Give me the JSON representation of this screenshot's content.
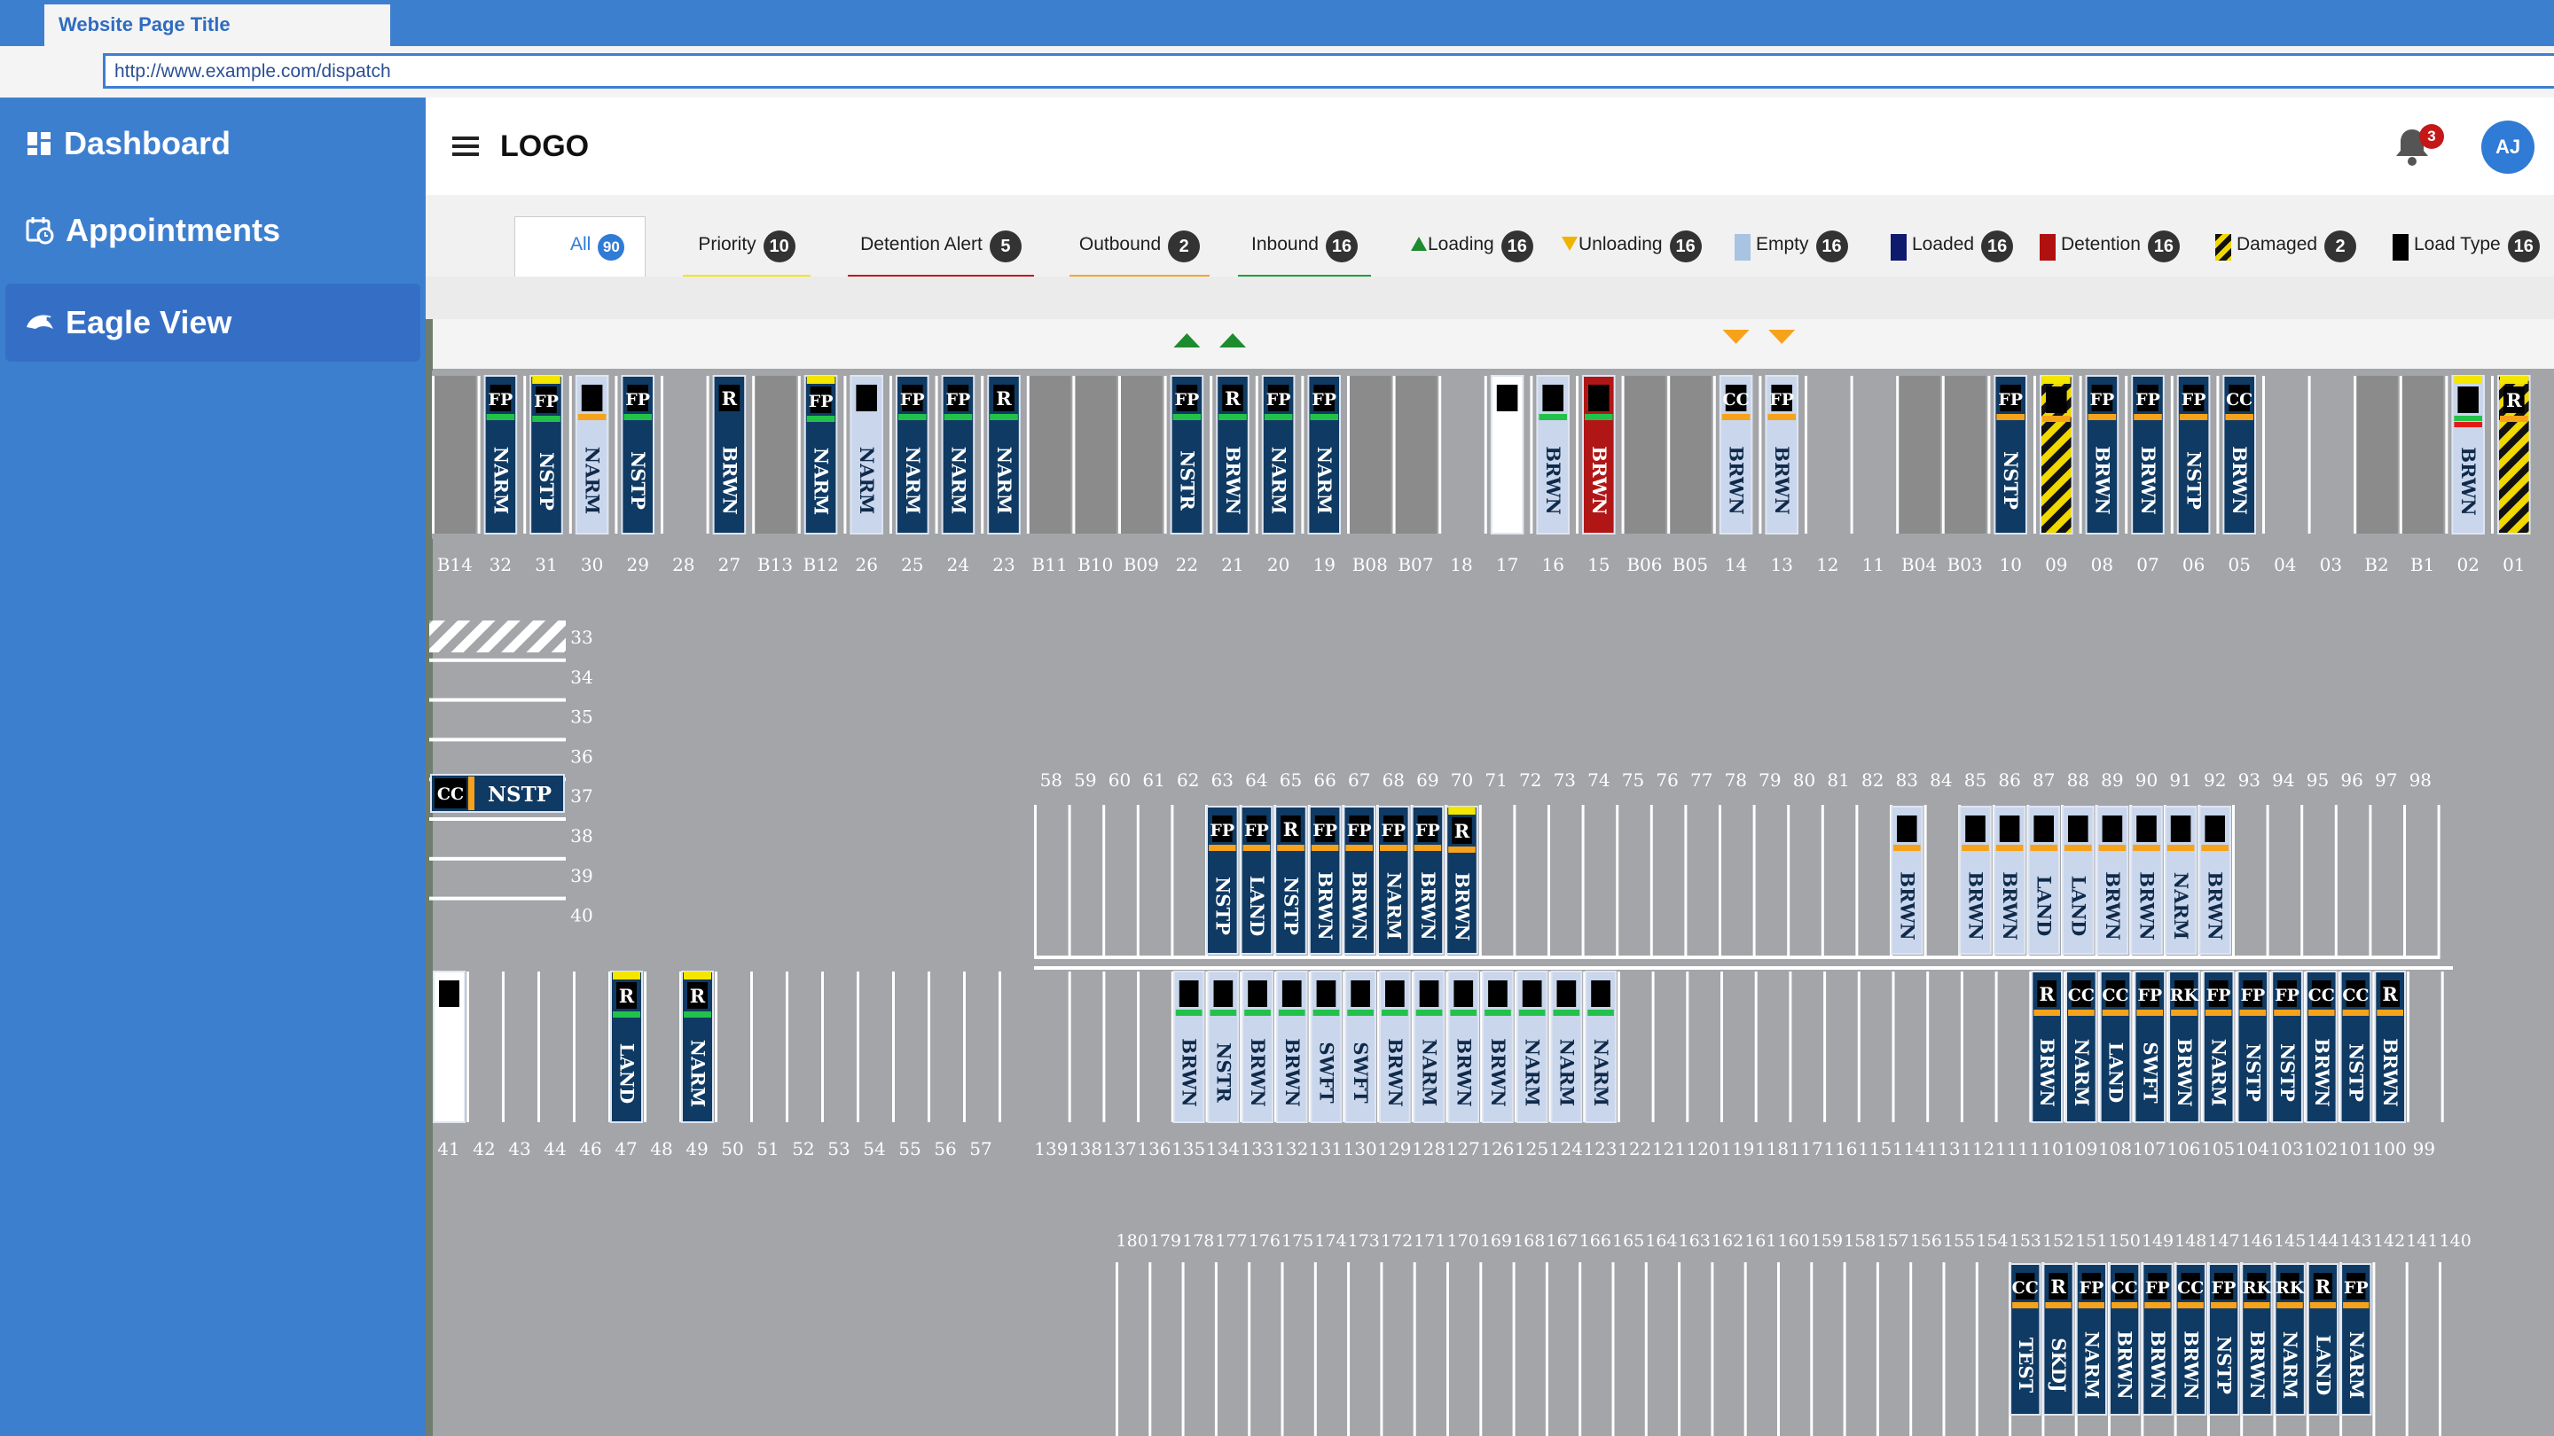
{
  "browser": {
    "tab_title": "Website Page Title",
    "url": "http://www.example.com/dispatch"
  },
  "sidebar": {
    "items": [
      {
        "label": "Dashboard",
        "icon": "dashboard-icon"
      },
      {
        "label": "Appointments",
        "icon": "calendar-clock-icon"
      },
      {
        "label": "Eagle View",
        "icon": "eagle-icon",
        "active": true
      }
    ]
  },
  "header": {
    "logo": "LOGO",
    "notifications": "3",
    "avatar": "AJ"
  },
  "filters": [
    {
      "label": "All",
      "count": "90",
      "underline": "#ffffff"
    },
    {
      "label": "Priority",
      "count": "10",
      "underline": "#f5e600"
    },
    {
      "label": "Detention Alert",
      "count": "5",
      "underline": "#c4161c"
    },
    {
      "label": "Outbound",
      "count": "2",
      "underline": "#f7a623"
    },
    {
      "label": "Inbound",
      "count": "16",
      "underline": "#1f9e3a"
    },
    {
      "label": "Loading",
      "count": "16",
      "swatch": "tri-up-green"
    },
    {
      "label": "Unloading",
      "count": "16",
      "swatch": "tri-down-yellow"
    },
    {
      "label": "Empty",
      "count": "16",
      "swatch": "#a9c3e3"
    },
    {
      "label": "Loaded",
      "count": "16",
      "swatch": "#0d1a6e"
    },
    {
      "label": "Detention",
      "count": "16",
      "swatch": "#b01010"
    },
    {
      "label": "Damaged",
      "count": "2",
      "swatch": "hazard"
    },
    {
      "label": "Load Type",
      "count": "16",
      "swatch": "#000000"
    }
  ],
  "colors": {
    "loaded": "#0f3a63",
    "empty": "#c9d6ec",
    "detention": "#b11616",
    "status_green": "#22c24a",
    "status_orange": "#f7a21b",
    "status_yellow": "#f5e600",
    "status_red": "#e31919",
    "lot": "#a3a5a8",
    "dock": "#8b8b8b"
  },
  "row1": {
    "indicators_up": [
      "22",
      "21"
    ],
    "indicators_down": [
      "14",
      "13"
    ],
    "doors": [
      {
        "n": "B14",
        "t": "b"
      },
      {
        "n": "32",
        "t": "l",
        "code": "FP",
        "c": "NARM",
        "bar": "g"
      },
      {
        "n": "31",
        "t": "l",
        "code": "FP",
        "c": "NSTP",
        "top": "y",
        "bar": "g"
      },
      {
        "n": "30",
        "t": "e",
        "code": "",
        "c": "NARM",
        "bar": "o"
      },
      {
        "n": "29",
        "t": "l",
        "code": "FP",
        "c": "NSTP",
        "bar": "g"
      },
      {
        "n": "28",
        "t": "x"
      },
      {
        "n": "27",
        "t": "l",
        "code": "R",
        "c": "BRWN"
      },
      {
        "n": "B13",
        "t": "b"
      },
      {
        "n": "B12",
        "t": "l",
        "code": "FP",
        "c": "NARM",
        "top": "y",
        "bar": "g"
      },
      {
        "n": "26",
        "t": "e",
        "code": "",
        "c": "NARM"
      },
      {
        "n": "25",
        "t": "l",
        "code": "FP",
        "c": "NARM",
        "bar": "g"
      },
      {
        "n": "24",
        "t": "l",
        "code": "FP",
        "c": "NARM",
        "bar": "g"
      },
      {
        "n": "23",
        "t": "l",
        "code": "R",
        "c": "NARM",
        "bar": "g"
      },
      {
        "n": "B11",
        "t": "b"
      },
      {
        "n": "B10",
        "t": "b"
      },
      {
        "n": "B09",
        "t": "b"
      },
      {
        "n": "22",
        "t": "l",
        "code": "FP",
        "c": "NSTR",
        "bar": "g"
      },
      {
        "n": "21",
        "t": "l",
        "code": "R",
        "c": "BRWN",
        "bar": "g"
      },
      {
        "n": "20",
        "t": "l",
        "code": "FP",
        "c": "NARM",
        "bar": "g"
      },
      {
        "n": "19",
        "t": "l",
        "code": "FP",
        "c": "NARM",
        "bar": "g"
      },
      {
        "n": "B08",
        "t": "b"
      },
      {
        "n": "B07",
        "t": "b"
      },
      {
        "n": "18",
        "t": "x"
      },
      {
        "n": "17",
        "t": "w",
        "code": ""
      },
      {
        "n": "16",
        "t": "e",
        "code": "",
        "c": "BRWN",
        "bar": "g"
      },
      {
        "n": "15",
        "t": "d",
        "code": "",
        "c": "BRWN",
        "bar": "g"
      },
      {
        "n": "B06",
        "t": "b"
      },
      {
        "n": "B05",
        "t": "b"
      },
      {
        "n": "14",
        "t": "e",
        "code": "CC",
        "c": "BRWN",
        "bar": "o"
      },
      {
        "n": "13",
        "t": "e",
        "code": "FP",
        "c": "BRWN",
        "bar": "o"
      },
      {
        "n": "12",
        "t": "x"
      },
      {
        "n": "11",
        "t": "x"
      },
      {
        "n": "B04",
        "t": "b"
      },
      {
        "n": "B03",
        "t": "b"
      },
      {
        "n": "10",
        "t": "l",
        "code": "FP",
        "c": "NSTP",
        "bar": "o"
      },
      {
        "n": "09",
        "t": "h",
        "code": "",
        "top": "y",
        "bar": "o"
      },
      {
        "n": "08",
        "t": "l",
        "code": "FP",
        "c": "BRWN",
        "bar": "o"
      },
      {
        "n": "07",
        "t": "l",
        "code": "FP",
        "c": "BRWN",
        "bar": "o"
      },
      {
        "n": "06",
        "t": "l",
        "code": "FP",
        "c": "NSTP",
        "bar": "o"
      },
      {
        "n": "05",
        "t": "l",
        "code": "CC",
        "c": "BRWN",
        "bar": "o"
      },
      {
        "n": "04",
        "t": "x"
      },
      {
        "n": "03",
        "t": "x"
      },
      {
        "n": "B2",
        "t": "b"
      },
      {
        "n": "B1",
        "t": "b"
      },
      {
        "n": "02",
        "t": "e",
        "code": "",
        "c": "BRWN",
        "top": "y",
        "bar": "gr"
      },
      {
        "n": "01",
        "t": "h",
        "code": "R",
        "top": "y",
        "bar": "o"
      }
    ]
  },
  "row_side": {
    "numbers": [
      "33",
      "34",
      "35",
      "36",
      "37",
      "38",
      "39",
      "40"
    ],
    "trailer": {
      "code": "CC",
      "c": "NSTP"
    }
  },
  "row2_top": {
    "numbers": [
      "58",
      "59",
      "60",
      "61",
      "62",
      "63",
      "64",
      "65",
      "66",
      "67",
      "68",
      "69",
      "70",
      "71",
      "72",
      "73",
      "74",
      "75",
      "76",
      "77",
      "78",
      "79",
      "80",
      "81",
      "82",
      "83",
      "84",
      "85",
      "86",
      "87",
      "88",
      "89",
      "90",
      "91",
      "92",
      "93",
      "94",
      "95",
      "96",
      "97",
      "98"
    ],
    "trailers": [
      {
        "n": "63",
        "t": "l",
        "code": "FP",
        "c": "NSTP",
        "bar": "o"
      },
      {
        "n": "64",
        "t": "l",
        "code": "FP",
        "c": "LAND",
        "bar": "o"
      },
      {
        "n": "65",
        "t": "l",
        "code": "R",
        "c": "NSTP",
        "bar": "o"
      },
      {
        "n": "66",
        "t": "l",
        "code": "FP",
        "c": "BRWN",
        "bar": "o"
      },
      {
        "n": "67",
        "t": "l",
        "code": "FP",
        "c": "BRWN",
        "bar": "o"
      },
      {
        "n": "68",
        "t": "l",
        "code": "FP",
        "c": "NARM",
        "bar": "o"
      },
      {
        "n": "69",
        "t": "l",
        "code": "FP",
        "c": "BRWN",
        "bar": "o"
      },
      {
        "n": "70",
        "t": "l",
        "code": "R",
        "c": "BRWN",
        "top": "y",
        "bar": "o"
      },
      {
        "n": "83",
        "t": "e",
        "code": "",
        "c": "BRWN",
        "bar": "o"
      },
      {
        "n": "85",
        "t": "e",
        "code": "",
        "c": "BRWN",
        "bar": "o"
      },
      {
        "n": "86",
        "t": "e",
        "code": "",
        "c": "BRWN",
        "bar": "o"
      },
      {
        "n": "87",
        "t": "e",
        "code": "",
        "c": "LAND",
        "bar": "o"
      },
      {
        "n": "88",
        "t": "e",
        "code": "",
        "c": "LAND",
        "bar": "o"
      },
      {
        "n": "89",
        "t": "e",
        "code": "",
        "c": "BRWN",
        "bar": "o"
      },
      {
        "n": "90",
        "t": "e",
        "code": "",
        "c": "BRWN",
        "bar": "o"
      },
      {
        "n": "91",
        "t": "e",
        "code": "",
        "c": "NARM",
        "bar": "o"
      },
      {
        "n": "92",
        "t": "e",
        "code": "",
        "c": "BRWN",
        "bar": "o"
      }
    ]
  },
  "row2_bottom": {
    "numbers": [
      "41",
      "42",
      "43",
      "44",
      "46",
      "47",
      "48",
      "49",
      "50",
      "51",
      "52",
      "53",
      "54",
      "55",
      "56",
      "57",
      "139",
      "138",
      "137",
      "136",
      "135",
      "134",
      "133",
      "132",
      "131",
      "130",
      "129",
      "128",
      "127",
      "126",
      "125",
      "124",
      "123",
      "122",
      "121",
      "120",
      "119",
      "118",
      "117",
      "116",
      "115",
      "114",
      "113",
      "112",
      "111",
      "110",
      "109",
      "108",
      "107",
      "106",
      "105",
      "104",
      "103",
      "102",
      "101",
      "100",
      "99"
    ],
    "trailers": [
      {
        "n": "41",
        "t": "w",
        "code": ""
      },
      {
        "n": "47",
        "t": "l",
        "code": "R",
        "c": "LAND",
        "top": "y",
        "bar": "g"
      },
      {
        "n": "49",
        "t": "l",
        "code": "R",
        "c": "NARM",
        "top": "y",
        "bar": "g"
      },
      {
        "n": "135",
        "t": "e",
        "code": "",
        "c": "BRWN",
        "bar": "g"
      },
      {
        "n": "134",
        "t": "e",
        "code": "",
        "c": "NSTR",
        "bar": "g"
      },
      {
        "n": "133",
        "t": "e",
        "code": "",
        "c": "BRWN",
        "bar": "g"
      },
      {
        "n": "132",
        "t": "e",
        "code": "",
        "c": "BRWN",
        "bar": "g"
      },
      {
        "n": "131",
        "t": "e",
        "code": "",
        "c": "SWFT",
        "bar": "g"
      },
      {
        "n": "130",
        "t": "e",
        "code": "",
        "c": "SWFT",
        "bar": "g"
      },
      {
        "n": "129",
        "t": "e",
        "code": "",
        "c": "BRWN",
        "bar": "g"
      },
      {
        "n": "128",
        "t": "e",
        "code": "",
        "c": "NARM",
        "bar": "g"
      },
      {
        "n": "127",
        "t": "e",
        "code": "",
        "c": "BRWN",
        "bar": "g"
      },
      {
        "n": "126",
        "t": "e",
        "code": "",
        "c": "BRWN",
        "bar": "g"
      },
      {
        "n": "125",
        "t": "e",
        "code": "",
        "c": "NARM",
        "bar": "g"
      },
      {
        "n": "124",
        "t": "e",
        "code": "",
        "c": "NARM",
        "bar": "g"
      },
      {
        "n": "123",
        "t": "e",
        "code": "",
        "c": "NARM",
        "bar": "g"
      },
      {
        "n": "110",
        "t": "l",
        "code": "R",
        "c": "BRWN",
        "bar": "o"
      },
      {
        "n": "109",
        "t": "l",
        "code": "CC",
        "c": "NARM",
        "bar": "o"
      },
      {
        "n": "108",
        "t": "l",
        "code": "CC",
        "c": "LAND",
        "bar": "o"
      },
      {
        "n": "107",
        "t": "l",
        "code": "FP",
        "c": "SWFT",
        "bar": "o"
      },
      {
        "n": "106",
        "t": "l",
        "code": "RK",
        "c": "BRWN",
        "bar": "o"
      },
      {
        "n": "105",
        "t": "l",
        "code": "FP",
        "c": "NARM",
        "bar": "o"
      },
      {
        "n": "104",
        "t": "l",
        "code": "FP",
        "c": "NSTP",
        "bar": "o"
      },
      {
        "n": "103",
        "t": "l",
        "code": "FP",
        "c": "NSTP",
        "bar": "o"
      },
      {
        "n": "102",
        "t": "l",
        "code": "CC",
        "c": "BRWN",
        "bar": "o"
      },
      {
        "n": "101",
        "t": "l",
        "code": "CC",
        "c": "NSTP",
        "bar": "o"
      },
      {
        "n": "100",
        "t": "l",
        "code": "R",
        "c": "BRWN",
        "bar": "o"
      }
    ]
  },
  "row3": {
    "numbers": [
      "180",
      "179",
      "178",
      "177",
      "176",
      "175",
      "174",
      "173",
      "172",
      "171",
      "170",
      "169",
      "168",
      "167",
      "166",
      "165",
      "164",
      "163",
      "162",
      "161",
      "160",
      "159",
      "158",
      "157",
      "156",
      "155",
      "154",
      "153",
      "152",
      "151",
      "150",
      "149",
      "148",
      "147",
      "146",
      "145",
      "144",
      "143",
      "142",
      "141",
      "140"
    ],
    "trailers": [
      {
        "n": "153",
        "t": "l",
        "code": "CC",
        "c": "TEST",
        "bar": "o"
      },
      {
        "n": "152",
        "t": "l",
        "code": "R",
        "c": "SKDJ",
        "bar": "o"
      },
      {
        "n": "151",
        "t": "l",
        "code": "FP",
        "c": "NARM",
        "bar": "o"
      },
      {
        "n": "150",
        "t": "l",
        "code": "CC",
        "c": "BRWN",
        "bar": "o"
      },
      {
        "n": "149",
        "t": "l",
        "code": "FP",
        "c": "BRWN",
        "bar": "o"
      },
      {
        "n": "148",
        "t": "l",
        "code": "CC",
        "c": "BRWN",
        "bar": "o"
      },
      {
        "n": "147",
        "t": "l",
        "code": "FP",
        "c": "NSTP",
        "bar": "o"
      },
      {
        "n": "146",
        "t": "l",
        "code": "RK",
        "c": "BRWN",
        "bar": "o"
      },
      {
        "n": "145",
        "t": "l",
        "code": "RK",
        "c": "NARM",
        "bar": "o"
      },
      {
        "n": "144",
        "t": "l",
        "code": "R",
        "c": "LAND",
        "bar": "o"
      },
      {
        "n": "143",
        "t": "l",
        "code": "FP",
        "c": "NARM",
        "bar": "o"
      }
    ]
  }
}
